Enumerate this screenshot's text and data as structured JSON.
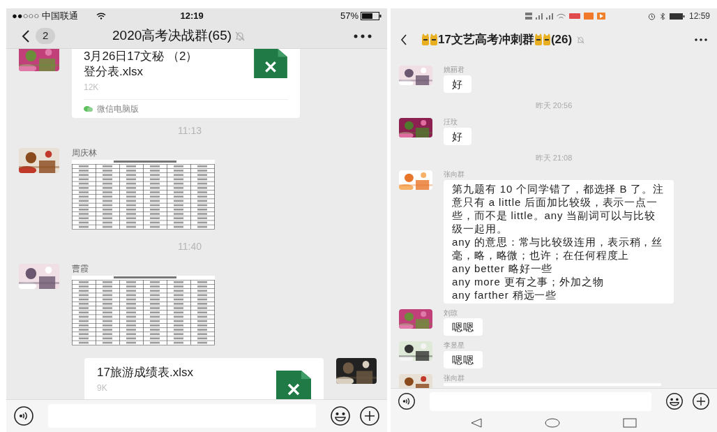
{
  "left_phone": {
    "status_bar": {
      "carrier": "●●○○○ 中国联通",
      "time": "12:19",
      "battery": "57%"
    },
    "nav": {
      "back_count": "2",
      "title": "2020高考决战群(65)",
      "muted": true
    },
    "messages": [
      {
        "kind": "file",
        "outgoing": false,
        "name": "3月26日17文秘 （2）登分表.xlsx",
        "size": "12K",
        "source": "微信电脑版"
      },
      {
        "kind": "time",
        "text": "11:13"
      },
      {
        "sender": "周庆林"
      },
      {
        "kind": "time",
        "text": "11:40"
      },
      {
        "sender": "曹霞"
      },
      {
        "kind": "file",
        "outgoing": true,
        "name": "17旅游成绩表.xlsx",
        "size": "9K"
      }
    ]
  },
  "right_phone": {
    "status_bar": {
      "time": "12:59"
    },
    "nav": {
      "title": "17文艺高考冲刺群",
      "count": "(26)",
      "muted": true
    },
    "messages": [
      {
        "kind": "text",
        "sender": "姚丽君",
        "text": "好"
      },
      {
        "kind": "time",
        "text": "昨天 20:56"
      },
      {
        "kind": "text",
        "sender": "汪玟",
        "text": "好"
      },
      {
        "kind": "time",
        "text": "昨天 21:08"
      },
      {
        "kind": "text",
        "sender": "张向群",
        "text": "第九题有 10 个同学错了，都选择 B 了。注意只有 a little 后面加比较级，表示一点一些，而不是 little。any 当副词可以与比较级一起用。\nany 的意思：常与比较级连用，表示稍，丝毫，略，略微；也许；在任何程度上\nany better 略好一些\nany more 更有之事；外加之物\nany farther 稍远一些"
      },
      {
        "kind": "text",
        "sender": "刘琼",
        "text": "嗯嗯"
      },
      {
        "kind": "text",
        "sender": "李昱星",
        "text": "嗯嗯"
      },
      {
        "kind": "cut",
        "sender": "张向群"
      }
    ]
  }
}
